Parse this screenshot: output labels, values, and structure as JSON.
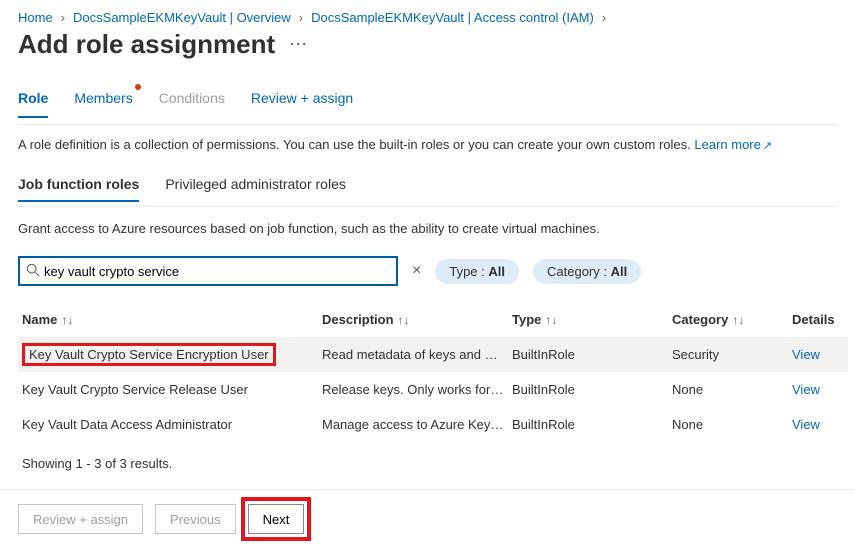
{
  "breadcrumb": {
    "home": "Home",
    "item1": "DocsSampleEKMKeyVault | Overview",
    "item2": "DocsSampleEKMKeyVault | Access control (IAM)"
  },
  "page_title": "Add role assignment",
  "tabs": {
    "role": "Role",
    "members": "Members",
    "conditions": "Conditions",
    "review": "Review + assign"
  },
  "description": {
    "text": "A role definition is a collection of permissions. You can use the built-in roles or you can create your own custom roles.",
    "learn_more": "Learn more"
  },
  "subtabs": {
    "job": "Job function roles",
    "priv": "Privileged administrator roles"
  },
  "subdesc": "Grant access to Azure resources based on job function, such as the ability to create virtual machines.",
  "search": {
    "value": "key vault crypto service"
  },
  "filters": {
    "type_label": "Type : ",
    "type_value": "All",
    "category_label": "Category : ",
    "category_value": "All"
  },
  "columns": {
    "name": "Name",
    "description": "Description",
    "type": "Type",
    "category": "Category",
    "details": "Details"
  },
  "rows": [
    {
      "name": "Key Vault Crypto Service Encryption User",
      "description": "Read metadata of keys and p…",
      "type": "BuiltInRole",
      "category": "Security",
      "details": "View"
    },
    {
      "name": "Key Vault Crypto Service Release User",
      "description": "Release keys. Only works for …",
      "type": "BuiltInRole",
      "category": "None",
      "details": "View"
    },
    {
      "name": "Key Vault Data Access Administrator",
      "description": "Manage access to Azure Key …",
      "type": "BuiltInRole",
      "category": "None",
      "details": "View"
    }
  ],
  "results_text": "Showing 1 - 3 of 3 results.",
  "footer": {
    "review": "Review + assign",
    "previous": "Previous",
    "next": "Next"
  }
}
